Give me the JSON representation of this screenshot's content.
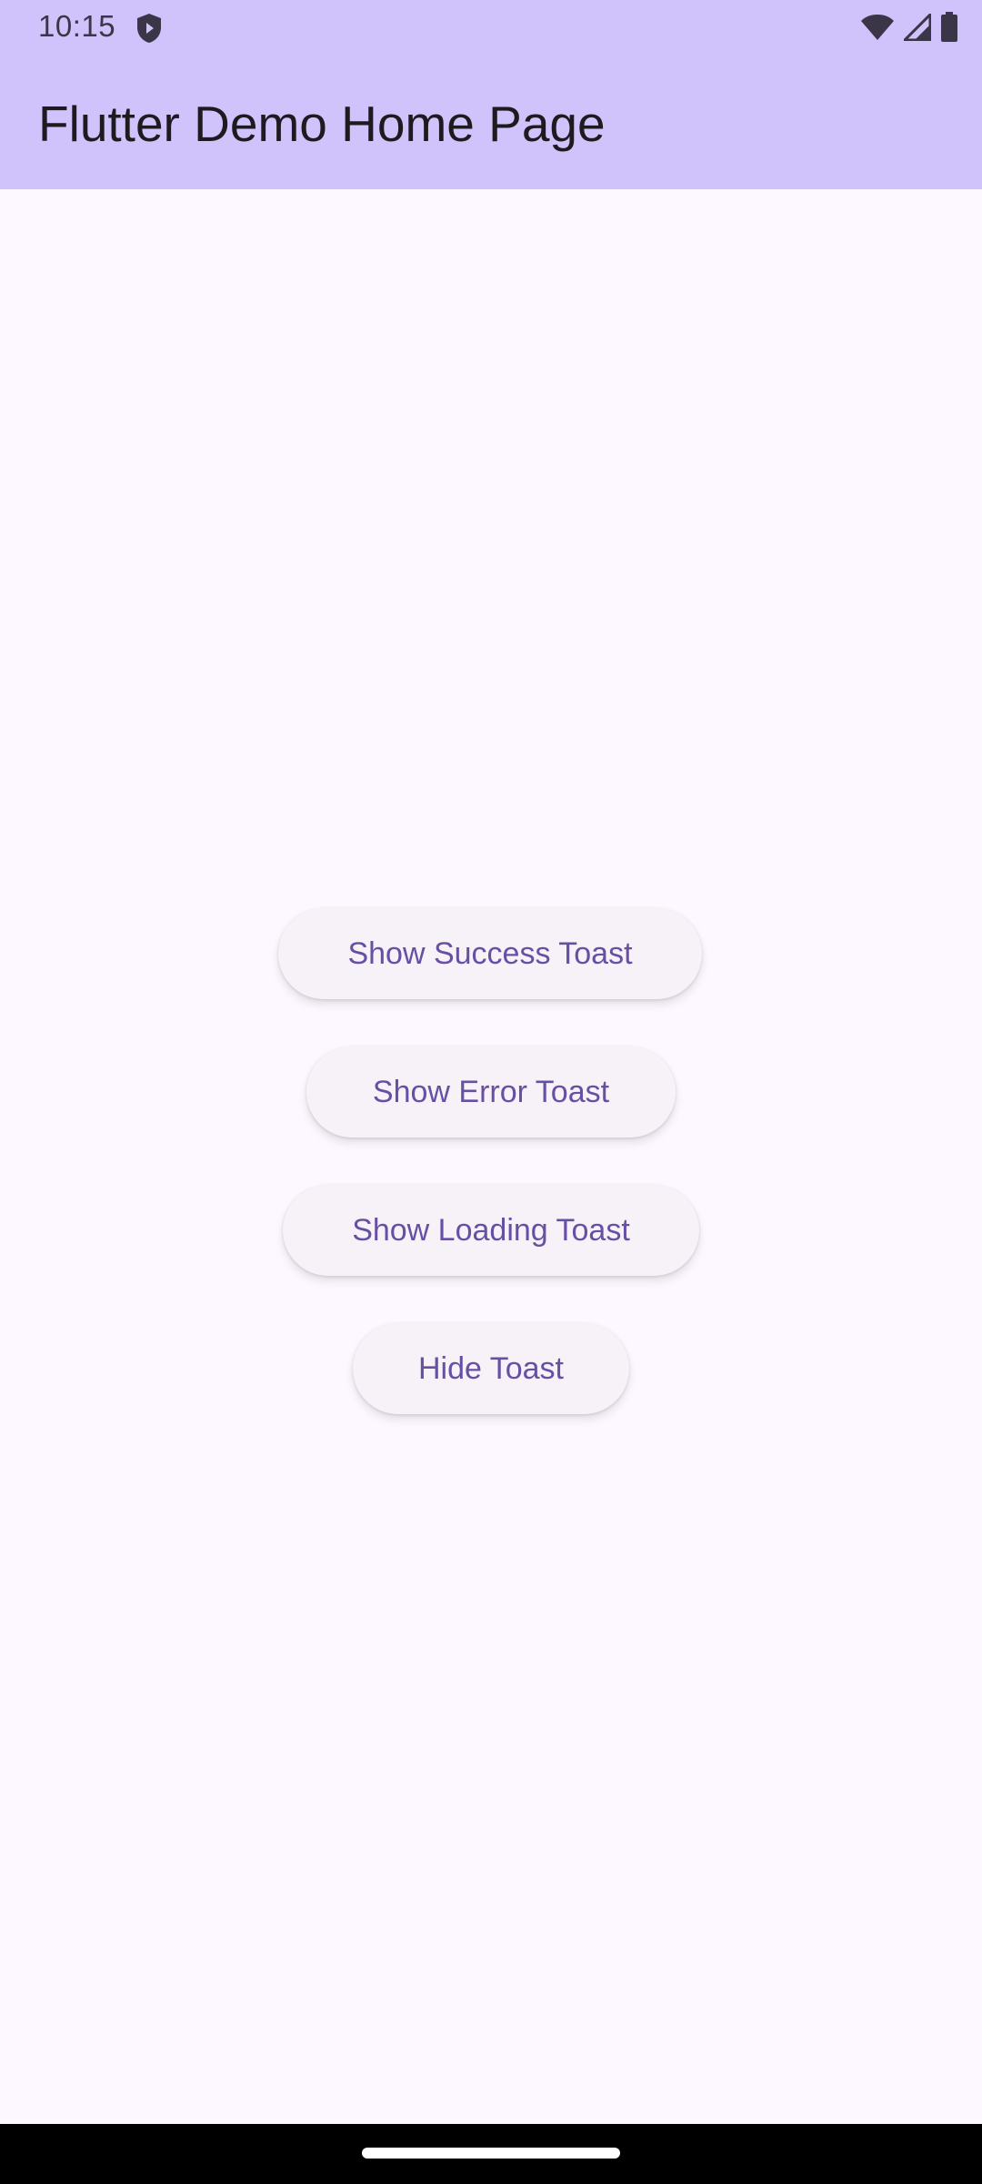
{
  "status_bar": {
    "time": "10:15",
    "icons": [
      "shield-icon",
      "wifi-icon",
      "signal-icon",
      "battery-icon"
    ]
  },
  "app_bar": {
    "title": "Flutter Demo Home Page"
  },
  "buttons": {
    "show_success": "Show Success Toast",
    "show_error": "Show Error Toast",
    "show_loading": "Show Loading Toast",
    "hide": "Hide Toast"
  },
  "colors": {
    "app_bar_bg": "#d0c3fb",
    "page_bg": "#fdf7ff",
    "button_bg": "#f7f1f8",
    "button_text": "#6750a4",
    "title_text": "#1d1b20"
  }
}
